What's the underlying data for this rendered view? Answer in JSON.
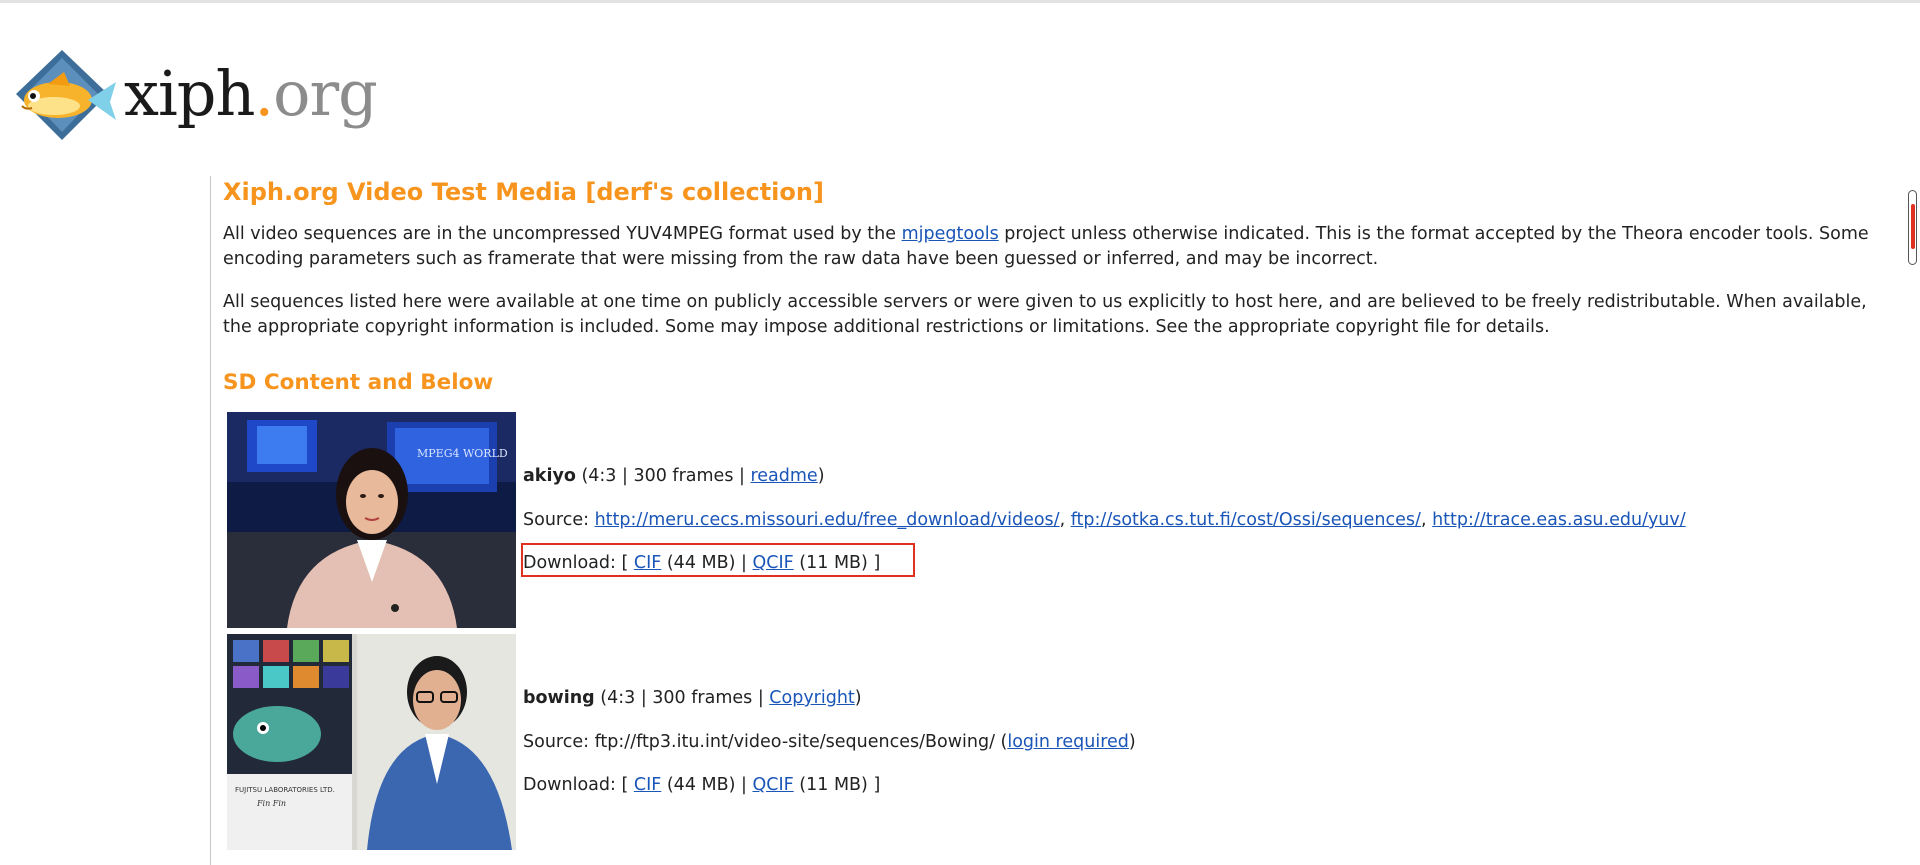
{
  "logo": {
    "text_main": "xiph",
    "text_dot": ".",
    "text_tld": "org",
    "colors": {
      "accent": "#f7941d",
      "fish_body": "#f7b32b",
      "diamond": "#3d6e99"
    }
  },
  "page": {
    "title": "Xiph.org Video Test Media [derf's collection]",
    "intro1_before_link": "All video sequences are in the uncompressed YUV4MPEG format used by the ",
    "intro1_link": "mjpegtools",
    "intro1_after_link": " project unless otherwise indicated. This is the format accepted by the Theora encoder tools. Some encoding parameters such as framerate that were missing from the raw data have been guessed or inferred, and may be incorrect.",
    "intro2": "All sequences listed here were available at one time on publicly accessible servers or were given to us explicitly to host here, and are believed to be freely redistributable. When available, the appropriate copyright information is included. Some may impose additional restrictions or limitations. See the appropriate copyright file for details.",
    "section_title": "SD Content and Below"
  },
  "labels": {
    "source": "Source: ",
    "download": "Download: ",
    "bracket_open": "[ ",
    "bracket_close": " ]",
    "sep": " | ",
    "comma": ", "
  },
  "clips": [
    {
      "name": "akiyo",
      "meta_open": " (4:3 | 300 frames | ",
      "meta_link": "readme",
      "meta_close": ")",
      "sources": [
        "http://meru.cecs.missouri.edu/free_download/videos/",
        "ftp://sotka.cs.tut.fi/cost/Ossi/sequences/",
        "http://trace.eas.asu.edu/yuv/"
      ],
      "cif_label": "CIF",
      "cif_size": " (44 MB)",
      "qcif_label": "QCIF",
      "qcif_size": " (11 MB)",
      "thumb_text": "MPEG4 WORLD"
    },
    {
      "name": "bowing",
      "meta_open": " (4:3 | 300 frames | ",
      "meta_link": "Copyright",
      "meta_close": ")",
      "source_text": "ftp://ftp3.itu.int/video-site/sequences/Bowing/ (",
      "source_link": "login required",
      "source_close": ")",
      "cif_label": "CIF",
      "cif_size": " (44 MB)",
      "qcif_label": "QCIF",
      "qcif_size": " (11 MB)",
      "thumb_text": "FUJITSU LABORATORIES LTD.",
      "thumb_subtext": "Fin Fin"
    }
  ]
}
